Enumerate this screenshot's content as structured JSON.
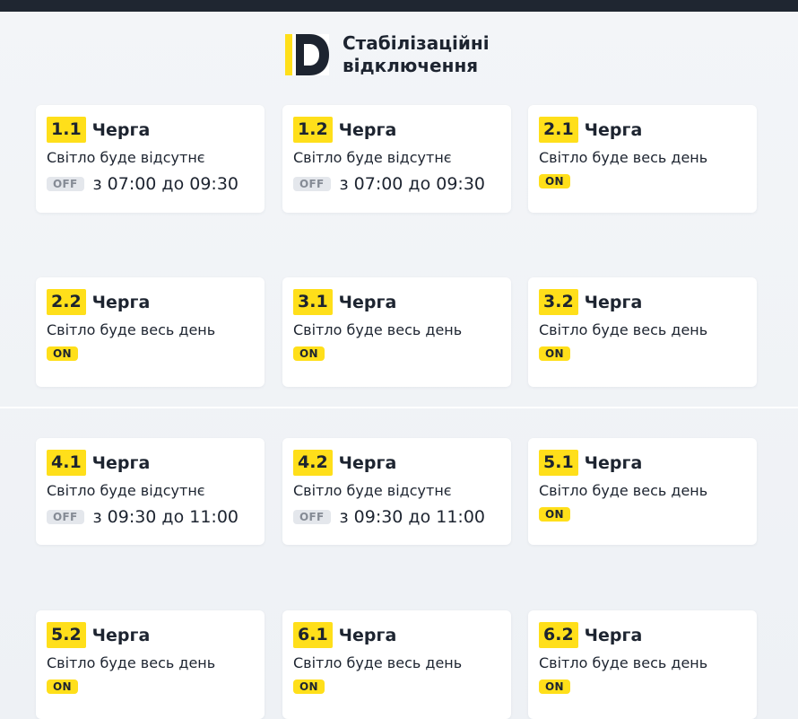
{
  "header": {
    "logo": "D",
    "title_line1": "Стабілізаційні",
    "title_line2": "відключення"
  },
  "cards": [
    {
      "queue": "1.1",
      "label": "Черга",
      "status": "Світло буде відсутнє",
      "state": "OFF",
      "time": "з 07:00 до 09:30"
    },
    {
      "queue": "1.2",
      "label": "Черга",
      "status": "Світло буде відсутнє",
      "state": "OFF",
      "time": "з 07:00 до 09:30"
    },
    {
      "queue": "2.1",
      "label": "Черга",
      "status": "Світло буде весь день",
      "state": "ON"
    },
    {
      "queue": "2.2",
      "label": "Черга",
      "status": "Світло буде весь день",
      "state": "ON"
    },
    {
      "queue": "3.1",
      "label": "Черга",
      "status": "Світло буде весь день",
      "state": "ON"
    },
    {
      "queue": "3.2",
      "label": "Черга",
      "status": "Світло буде весь день",
      "state": "ON"
    },
    {
      "queue": "4.1",
      "label": "Черга",
      "status": "Світло буде відсутнє",
      "state": "OFF",
      "time": "з 09:30 до 11:00"
    },
    {
      "queue": "4.2",
      "label": "Черга",
      "status": "Світло буде відсутнє",
      "state": "OFF",
      "time": "з 09:30 до 11:00"
    },
    {
      "queue": "5.1",
      "label": "Черга",
      "status": "Світло буде весь день",
      "state": "ON"
    },
    {
      "queue": "5.2",
      "label": "Черга",
      "status": "Світло буде весь день",
      "state": "ON"
    },
    {
      "queue": "6.1",
      "label": "Черга",
      "status": "Світло буде весь день",
      "state": "ON"
    },
    {
      "queue": "6.2",
      "label": "Черга",
      "status": "Світло буде весь день",
      "state": "ON"
    }
  ],
  "colors": {
    "accent": "#ffdf1a",
    "text": "#1d2430",
    "off_pill": "#e4e7ec",
    "off_text": "#858b95",
    "topbar": "#1f2631"
  }
}
